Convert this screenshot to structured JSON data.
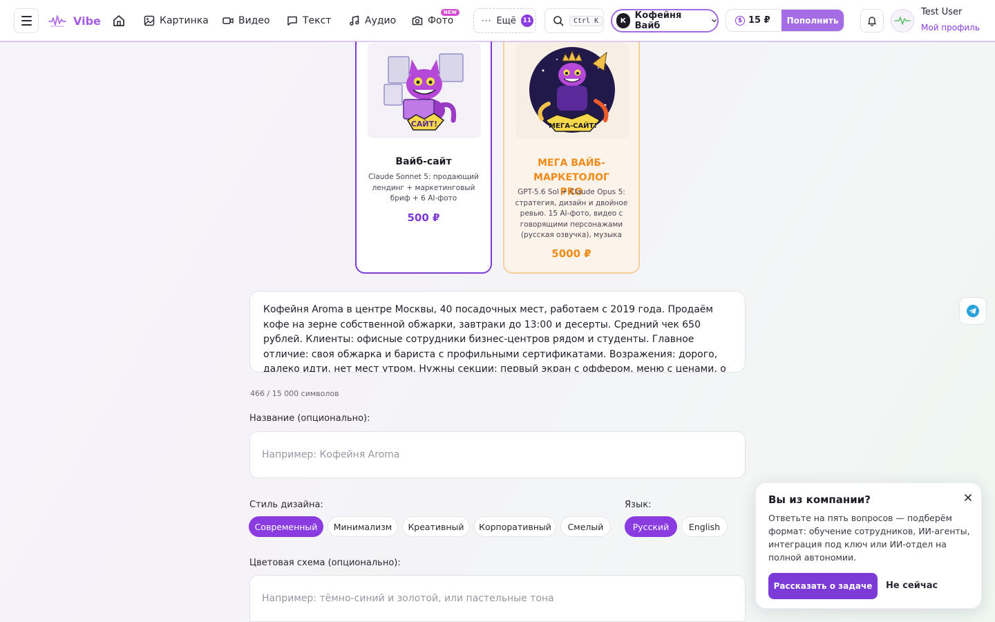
{
  "header": {
    "logo_text": "Vibe",
    "nav": [
      {
        "label": "Картинка",
        "icon": "image-icon"
      },
      {
        "label": "Видео",
        "icon": "video-icon"
      },
      {
        "label": "Текст",
        "icon": "chat-icon"
      },
      {
        "label": "Аудио",
        "icon": "music-icon"
      },
      {
        "label": "Фото",
        "icon": "camera-icon"
      }
    ],
    "photo_badge": "NEW",
    "more_label": "Ещё",
    "more_count": "11",
    "search_shortcut": "Ctrl K",
    "workspace_initial": "К",
    "workspace_name": "Кофейня Вайб",
    "balance": "15 ₽",
    "balance_symbol": "$",
    "topup_label": "Пополнить",
    "user_name": "Test User",
    "profile_link": "Мой профиль",
    "accent_color": "#8a3ce0"
  },
  "cards": [
    {
      "title": "Вайб-сайт",
      "description": "Claude Sonnet 5: продающий лендинг + маркетинговый бриф + 6 AI-фото",
      "price": "500 ₽",
      "badge_text": "САЙТ!",
      "selected": true
    },
    {
      "title": "МЕГА ВАЙБ-МАРКЕТОЛОГ PRO",
      "description": "GPT-5.6 Sol + Claude Opus 5: стратегия, дизайн и двойное ревью. 15 AI-фото, видео с говорящими персонажами (русская озвучка), музыка",
      "price": "5000 ₽",
      "badge_text": "МЕГА-САЙТ!",
      "selected": false
    }
  ],
  "form": {
    "description_text": "Кофейня Aroma в центре Москвы, 40 посадочных мест, работаем с 2019 года. Продаём кофе на зерне собственной обжарки, завтраки до 13:00 и десерты. Средний чек 650 рублей. Клиенты: офисные сотрудники бизнес-центров рядом и студенты. Главное отличие: своя обжарка и бариста с профильными сертификатами. Возражения: дорого, далеко идти, нет мест утром. Нужны секции: первый экран с оффером, меню с ценами, о нашей обжарке, отзывы гостей, как",
    "char_count": "466 / 15 000 символов",
    "name_label": "Название (опционально):",
    "name_placeholder": "Например: Кофейня Aroma",
    "style_label": "Стиль дизайна:",
    "styles": [
      "Современный",
      "Минимализм",
      "Креативный",
      "Корпоративный",
      "Смелый"
    ],
    "style_selected": "Современный",
    "language_label": "Язык:",
    "languages": [
      "Русский",
      "English"
    ],
    "language_selected": "Русский",
    "color_label": "Цветовая схема (опционально):",
    "color_placeholder": "Например: тёмно-синий и золотой, или пастельные тона"
  },
  "popup": {
    "title": "Вы из компании?",
    "text": "Ответьте на пять вопросов — подберём формат: обучение сотрудников, ИИ-агенты, интеграция под ключ или ИИ-отдел на полной автономии.",
    "primary_label": "Рассказать о задаче",
    "secondary_label": "Не сейчас"
  }
}
